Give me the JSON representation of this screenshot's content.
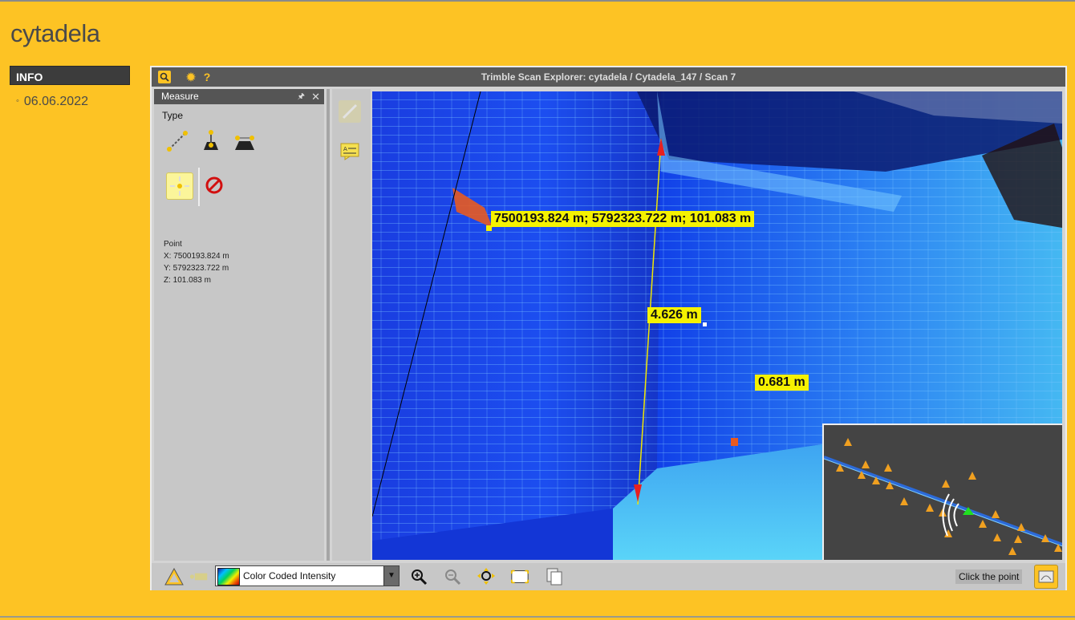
{
  "page": {
    "title": "cytadela"
  },
  "sidebar": {
    "tab_label": "INFO",
    "items": [
      {
        "label": "06.06.2022"
      }
    ]
  },
  "viewer": {
    "title": "Trimble Scan Explorer: cytadela / Cytadela_147 / Scan 7",
    "toolbar_icons": [
      "search-icon",
      "gear-icon",
      "help-icon"
    ],
    "measure_panel": {
      "title": "Measure",
      "type_label": "Type",
      "type_icons": [
        "point-to-point-icon",
        "vertical-distance-icon",
        "horizontal-distance-icon"
      ],
      "point": {
        "heading": "Point",
        "x": "X: 7500193.824 m",
        "y": "Y: 5792323.722 m",
        "z": "Z: 101.083 m"
      }
    },
    "scan": {
      "coord_label": "7500193.824 m; 5792323.722 m; 101.083 m",
      "distance_label": "4.626 m",
      "short_label": "0.681 m"
    },
    "bottom": {
      "color_mode": "Color Coded Intensity",
      "status": "Click the point"
    }
  },
  "colors": {
    "accent": "#fdc324",
    "label_bg": "#f5f200",
    "header_dark": "#595959"
  }
}
